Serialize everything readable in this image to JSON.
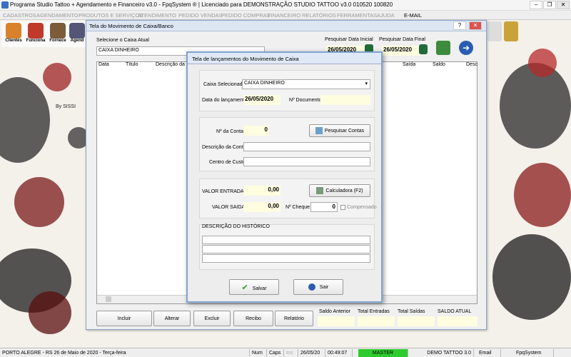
{
  "app": {
    "title": "Programa Studio Tattoo + Agendamento e Financeiro v3.0 - FpqSystem ® | Licenciado para  DEMONSTRAÇÃO STUDIO TATTOO v3.0 010520 100820"
  },
  "menu": [
    "CADASTROS",
    "AGENDAMENTO",
    "PRODUTOS E SERVIÇOS",
    "ATENDIMENTO",
    "PEDIDO VENDAS",
    "PEDIDO COMPRAS",
    "FINANCEIRO",
    "RELATÓRIOS",
    "FERRAMENTAS",
    "AJUDA",
    "E-MAIL"
  ],
  "toolbar": {
    "clientes": "Clientes",
    "funciona": "Funciona",
    "fornece": "Fornece",
    "agend": "Agend"
  },
  "desktop": {
    "by_text": "By SISSI"
  },
  "movimento": {
    "title": "Tela do Movimento de Caixa/Banco",
    "select_label": "Selecione o Caixa Atual",
    "select_value": "CAIXA DINHEIRO",
    "date_start_label": "Pesquisar Data Inicial",
    "date_start": "26/05/2020",
    "date_end_label": "Pesquisar Data Final",
    "date_end": "26/05/2020",
    "columns": {
      "data": "Data",
      "titulo": "Título",
      "descricao": "Descrição da Co",
      "saida": "Saída",
      "saldo": "Saldo",
      "desc2": "Desc"
    },
    "buttons": {
      "incluir": "Incluir",
      "alterar": "Alterar",
      "excluir": "Excluir",
      "recibo": "Recibo",
      "relatorio": "Relatório"
    },
    "totals": {
      "saldo_anterior": "Saldo Anterior",
      "total_entradas": "Total Entradas",
      "total_saidas": "Total Saídas",
      "saldo_atual": "SALDO ATUAL"
    }
  },
  "dialog": {
    "title": "Tela de lançamentos do Movimento de Caixa",
    "caixa_label": "Caixa Selecionado",
    "caixa_value": "CAIXA DINHEIRO",
    "data_label": "Data do lançamento",
    "data_value": "26/05/2020",
    "doc_label": "Nº Documento",
    "conta_label": "Nº da Conta",
    "conta_value": "0",
    "pesquisar_btn": "Pesquisar Contas",
    "descricao_conta_label": "Descrição da Conta",
    "centro_label": "Centro de Custo",
    "entrada_label": "VALOR ENTRADA",
    "entrada_value": "0,00",
    "calc_btn": "Calculadora  (F2)",
    "saida_label": "VALOR SAIDA",
    "saida_value": "0,00",
    "cheque_label": "Nº Cheque",
    "cheque_value": "0",
    "compensado_label": "Compensado",
    "historico_label": "DESCRIÇÃO DO HISTÓRICO",
    "salvar_btn": "Salvar",
    "sair_btn": "Sair"
  },
  "status": {
    "city": "PORTO ALEGRE - RS 26 de Maio de 2020 - Terça-feira",
    "num": "Num",
    "caps": "Caps",
    "ins": "Ins",
    "date": "26/05/20",
    "time": "00:49:07",
    "master": "MASTER",
    "demo": "DEMO TATTOO 3.0",
    "email": "Email",
    "fpq": "FpqSystem"
  },
  "colors": {
    "accent": "#2a5db0",
    "master_bg": "#2ecc2e",
    "yellow_field": "#fefde0"
  }
}
